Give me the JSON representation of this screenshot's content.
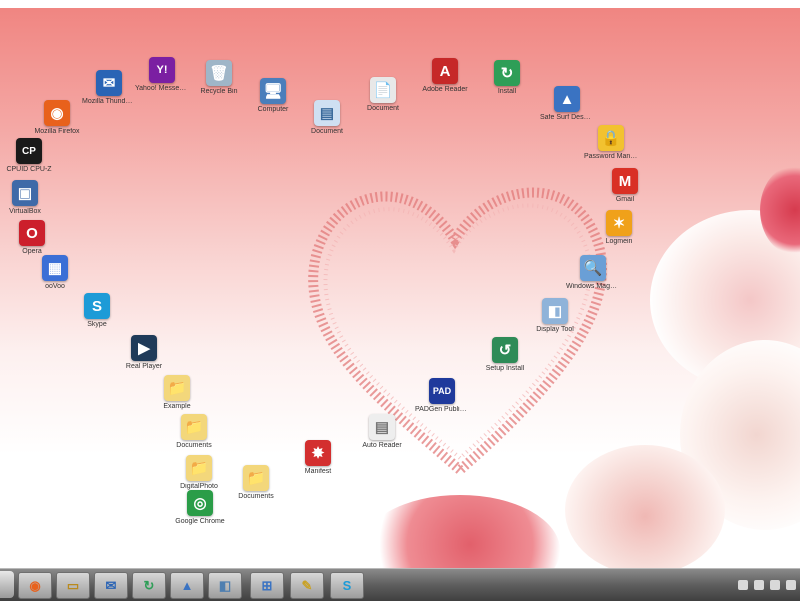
{
  "desktop": {
    "icons": [
      {
        "label": "Mozilla Thunderbird",
        "icon": "thunderbird-icon",
        "glyph": "✉",
        "color": "#2a64b5"
      },
      {
        "label": "Yahoo! Messenger",
        "icon": "yahoo-messenger-icon",
        "glyph": "Y!",
        "color": "#7b1fa2"
      },
      {
        "label": "Recycle Bin",
        "icon": "recycle-bin-icon",
        "glyph": "🗑",
        "color": "#9fb6c8"
      },
      {
        "label": "Computer",
        "icon": "computer-icon",
        "glyph": "🖥",
        "color": "#4a7ebb"
      },
      {
        "label": "Document",
        "icon": "document-icon",
        "glyph": "📄",
        "color": "#e8e8e8"
      },
      {
        "label": "Mozilla Firefox",
        "icon": "firefox-icon",
        "glyph": "◉",
        "color": "#e8611c"
      },
      {
        "label": "Document",
        "icon": "text-document-icon",
        "glyph": "▤",
        "color": "#cfe0f2"
      },
      {
        "label": "Adobe Reader",
        "icon": "adobe-reader-icon",
        "glyph": "A",
        "color": "#c62828"
      },
      {
        "label": "Install",
        "icon": "install-icon",
        "glyph": "↻",
        "color": "#2e9e57"
      },
      {
        "label": "Safe Surf Desktop",
        "icon": "safesurf-icon",
        "glyph": "▲",
        "color": "#3a73c2"
      },
      {
        "label": "CPUID CPU-Z",
        "icon": "cpuz-icon",
        "glyph": "CP",
        "color": "#1a1a1a"
      },
      {
        "label": "Password Manager",
        "icon": "password-manager-icon",
        "glyph": "🔒",
        "color": "#f2c230"
      },
      {
        "label": "VirtualBox",
        "icon": "virtualbox-icon",
        "glyph": "▣",
        "color": "#3f6aa8"
      },
      {
        "label": "Gmail",
        "icon": "gmail-icon",
        "glyph": "M",
        "color": "#d93025"
      },
      {
        "label": "Opera",
        "icon": "opera-icon",
        "glyph": "O",
        "color": "#cc1f2c"
      },
      {
        "label": "Logmein",
        "icon": "logmein-icon",
        "glyph": "✶",
        "color": "#f0a11a"
      },
      {
        "label": "ooVoo",
        "icon": "oovoo-icon",
        "glyph": "▦",
        "color": "#3b6fd6"
      },
      {
        "label": "Windows Magnifier",
        "icon": "magnifier-icon",
        "glyph": "🔍",
        "color": "#6a9fd6"
      },
      {
        "label": "Skype",
        "icon": "skype-icon",
        "glyph": "S",
        "color": "#1d9bd7"
      },
      {
        "label": "Display Tool",
        "icon": "display-tool-icon",
        "glyph": "◧",
        "color": "#8fb3d9"
      },
      {
        "label": "Real Player",
        "icon": "realplayer-icon",
        "glyph": "▶",
        "color": "#1f3b59"
      },
      {
        "label": "Setup Install",
        "icon": "setup-install-icon",
        "glyph": "↺",
        "color": "#2e8b57"
      },
      {
        "label": "Example",
        "icon": "folder-icon",
        "glyph": "📁",
        "color": "#f3d77b"
      },
      {
        "label": "PADGen Publisher",
        "icon": "padgen-icon",
        "glyph": "PAD",
        "color": "#1f3a9c"
      },
      {
        "label": "Documents",
        "icon": "folder-icon",
        "glyph": "📁",
        "color": "#f3d77b"
      },
      {
        "label": "Auto Reader",
        "icon": "text-file-icon",
        "glyph": "▤",
        "color": "#eeeeee"
      },
      {
        "label": "Manifest",
        "icon": "manifest-icon",
        "glyph": "✸",
        "color": "#d32f2f"
      },
      {
        "label": "DigitalPhoto",
        "icon": "folder-icon",
        "glyph": "📁",
        "color": "#f3d77b"
      },
      {
        "label": "Documents",
        "icon": "folder-icon",
        "glyph": "📁",
        "color": "#f3d77b"
      },
      {
        "label": "Google Chrome",
        "icon": "chrome-icon",
        "glyph": "◎",
        "color": "#2a9d48"
      }
    ]
  },
  "taskbar": {
    "buttons": [
      {
        "icon": "firefox-icon",
        "glyph": "◉",
        "color": "#e8611c"
      },
      {
        "icon": "explorer-icon",
        "glyph": "▭",
        "color": "#e6c35a"
      },
      {
        "icon": "thunderbird-icon",
        "glyph": "✉",
        "color": "#2a64b5"
      },
      {
        "icon": "install-icon",
        "glyph": "↻",
        "color": "#2e9e57"
      },
      {
        "icon": "safesurf-icon",
        "glyph": "▲",
        "color": "#3a73c2"
      },
      {
        "icon": "display-tool-icon",
        "glyph": "◧",
        "color": "#8fb3d9"
      },
      {
        "icon": "windows-logo-icon",
        "glyph": "⊞",
        "color": "#3a73c2"
      },
      {
        "icon": "notes-icon",
        "glyph": "✎",
        "color": "#c9a227"
      },
      {
        "icon": "skype-icon",
        "glyph": "S",
        "color": "#1d9bd7"
      }
    ]
  }
}
